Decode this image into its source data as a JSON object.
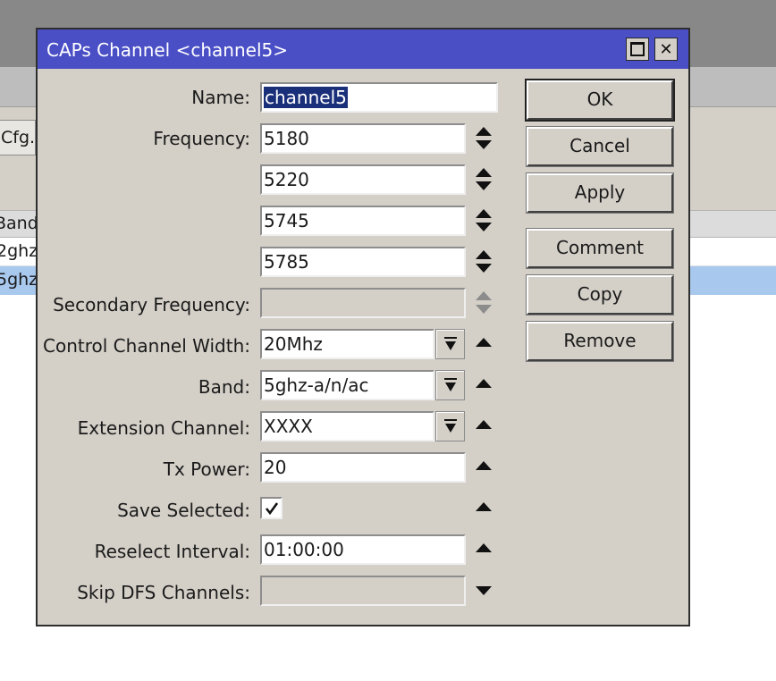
{
  "background": {
    "toolbar_button": "Cfg.",
    "column_header": "Band",
    "rows": [
      "2ghz",
      "5ghz"
    ]
  },
  "dialog": {
    "title": "CAPs Channel <channel5>",
    "fields": {
      "name_label": "Name:",
      "name_value": "channel5",
      "frequency_label": "Frequency:",
      "frequencies": [
        "5180",
        "5220",
        "5745",
        "5785"
      ],
      "secondary_frequency_label": "Secondary Frequency:",
      "secondary_frequency_value": "",
      "control_channel_width_label": "Control Channel Width:",
      "control_channel_width_value": "20Mhz",
      "band_label": "Band:",
      "band_value": "5ghz-a/n/ac",
      "extension_channel_label": "Extension Channel:",
      "extension_channel_value": "XXXX",
      "tx_power_label": "Tx Power:",
      "tx_power_value": "20",
      "save_selected_label": "Save Selected:",
      "save_selected_checked": true,
      "reselect_interval_label": "Reselect Interval:",
      "reselect_interval_value": "01:00:00",
      "skip_dfs_channels_label": "Skip DFS Channels:",
      "skip_dfs_channels_value": ""
    },
    "buttons": {
      "ok": "OK",
      "cancel": "Cancel",
      "apply": "Apply",
      "comment": "Comment",
      "copy": "Copy",
      "remove": "Remove"
    }
  },
  "icons": {
    "updown": "updown-arrows-icon",
    "expand": "triangle-up-icon",
    "collapse": "triangle-down-icon",
    "dropdown": "dropdown-arrow-icon"
  },
  "colors": {
    "titlebar": "#4a4fc6",
    "dialog_bg": "#d4d0c8",
    "selected_row": "#a8c8ee",
    "selection_highlight": "#1a2f7a"
  }
}
